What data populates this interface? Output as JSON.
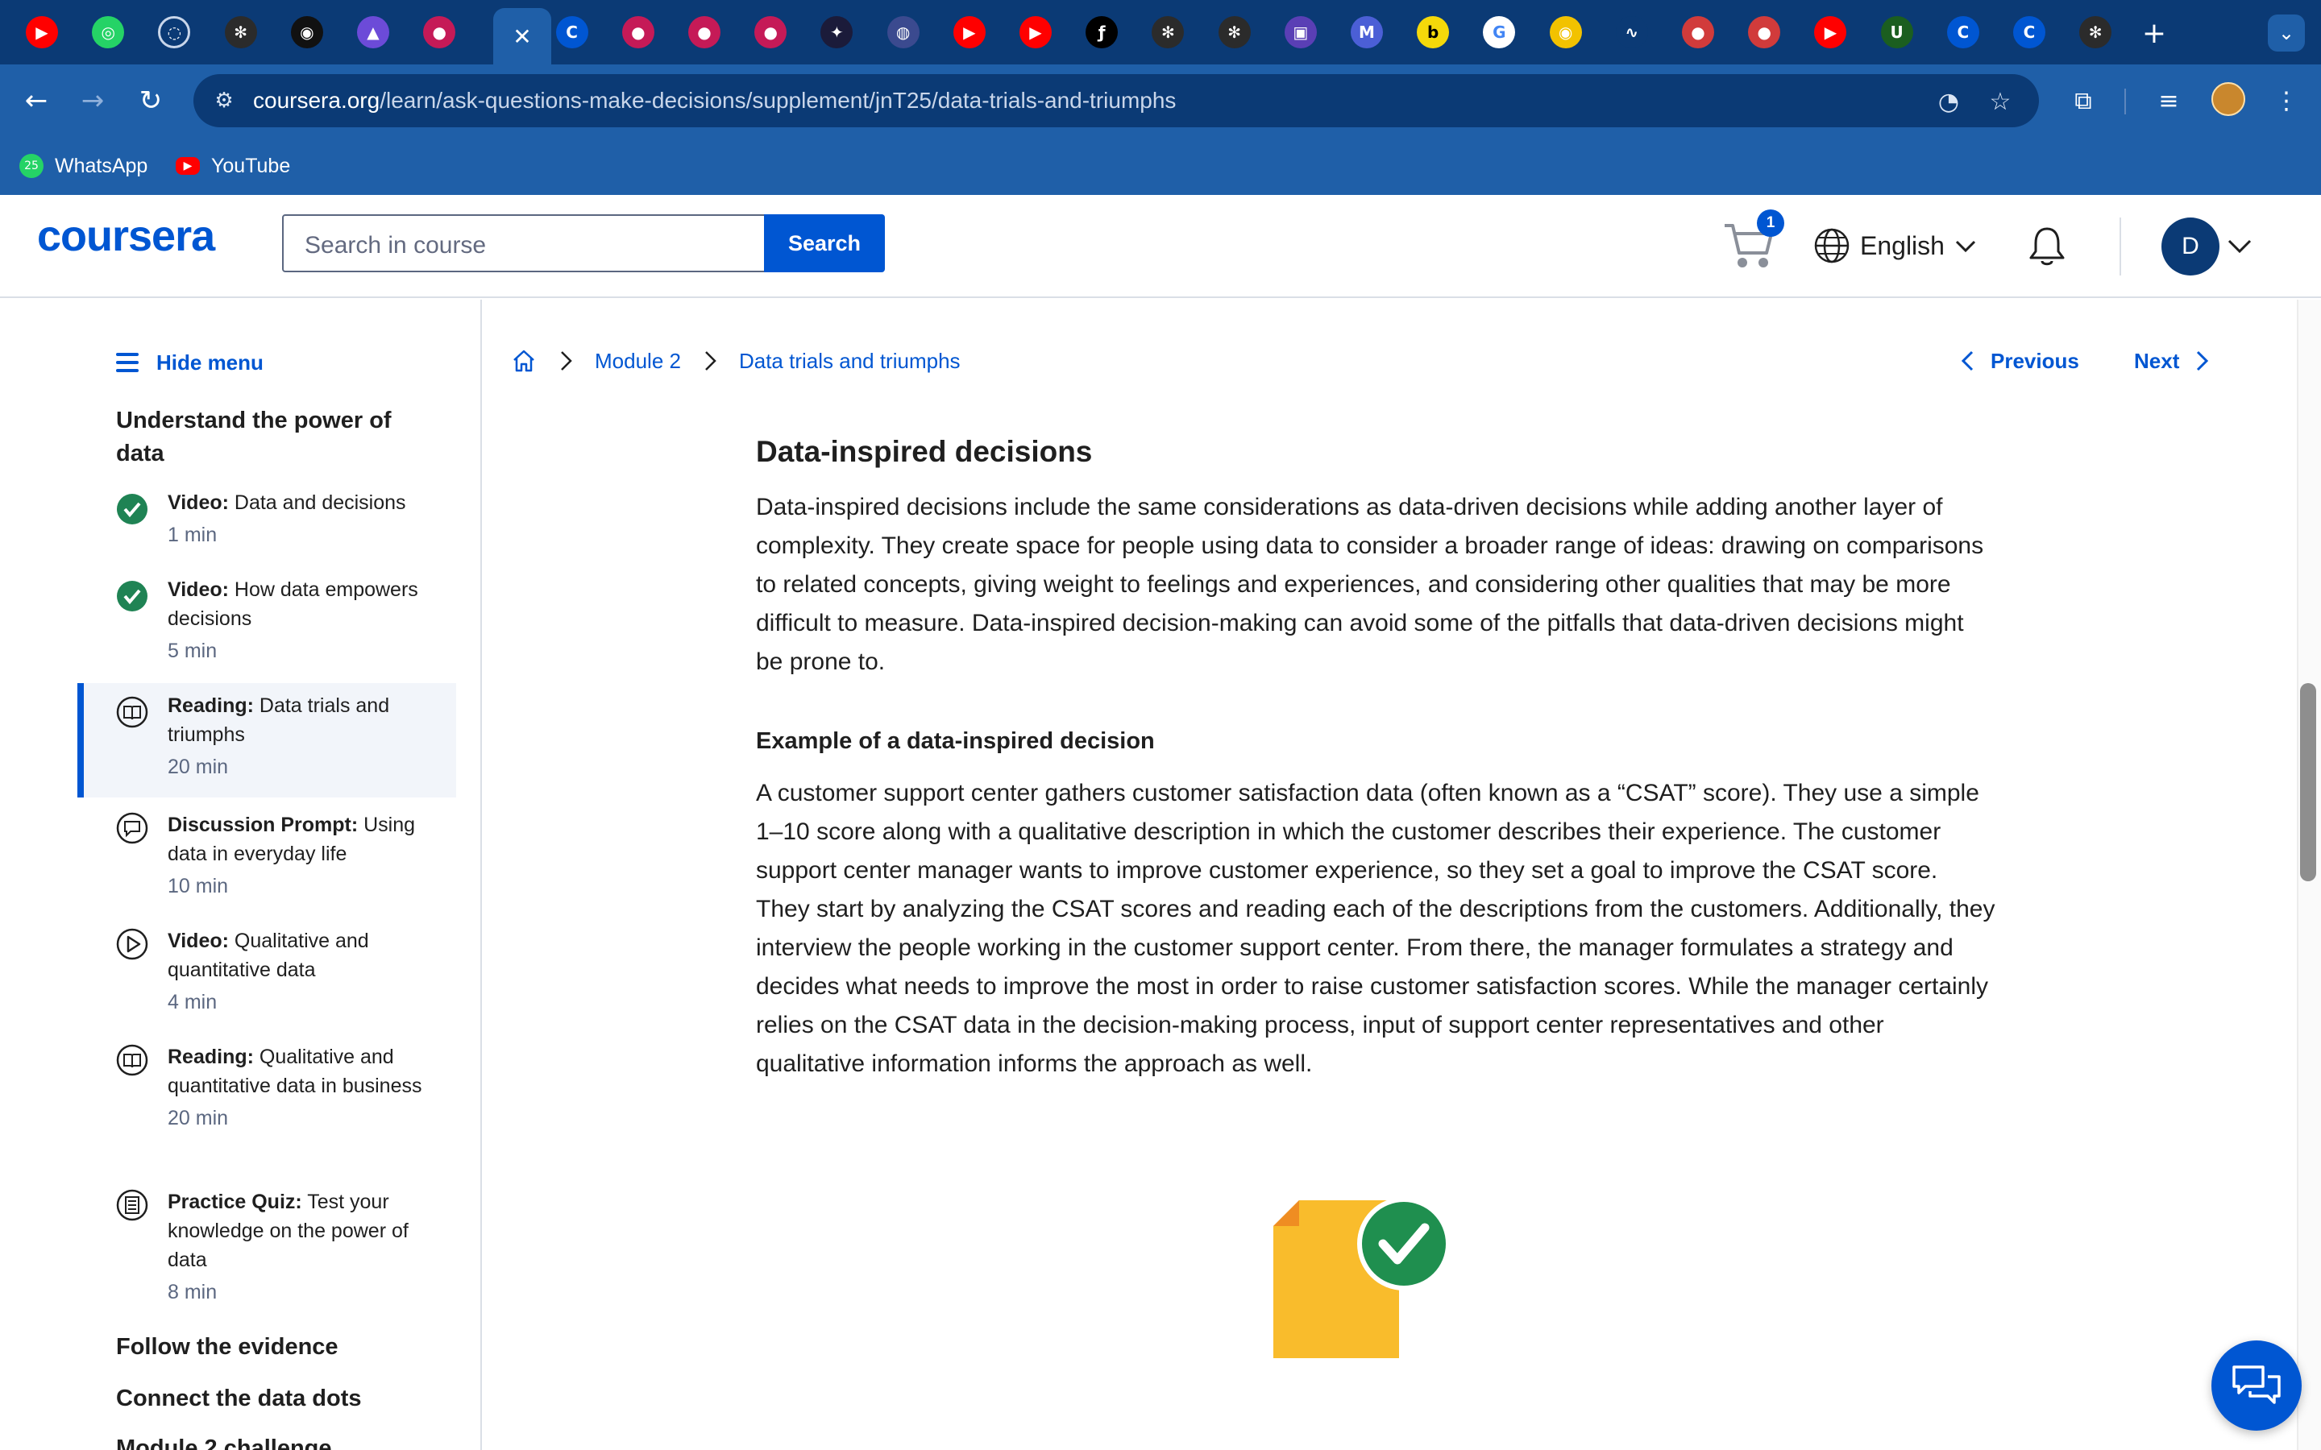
{
  "browser": {
    "tab_favicons": [
      "youtube",
      "whatsapp",
      "loading",
      "openai",
      "github",
      "stack",
      "record",
      "active",
      "coursera",
      "record",
      "record",
      "record",
      "dark",
      "globe",
      "youtube",
      "youtube",
      "signature",
      "openai",
      "openai",
      "camera",
      "m",
      "b",
      "google",
      "circle",
      "wave",
      "ball",
      "ball",
      "youtube",
      "my-unt",
      "coursera",
      "coursera",
      "openai"
    ],
    "active_tab_close": "✕",
    "new_tab_label": "+",
    "tab_search_icon": "⌄",
    "url_host": "coursera.org",
    "url_path": "/learn/ask-questions-make-decisions/supplement/jnT25/data-trials-and-triumphs",
    "bookmarks": [
      {
        "label": "WhatsApp",
        "icon": "whatsapp-icon",
        "badge": "25"
      },
      {
        "label": "YouTube",
        "icon": "youtube-icon"
      }
    ]
  },
  "header": {
    "logo": "coursera",
    "search_placeholder": "Search in course",
    "search_button": "Search",
    "cart_count": "1",
    "language": "English",
    "avatar_initial": "D",
    "brand_color": "#0056d2"
  },
  "sidebar": {
    "hide_menu": "Hide menu",
    "section_title": "Understand the power of data",
    "items": [
      {
        "type": "Video:",
        "title": "Data and decisions",
        "duration": "1 min",
        "status": "completed"
      },
      {
        "type": "Video:",
        "title": "How data empowers decisions",
        "duration": "5 min",
        "status": "completed"
      },
      {
        "type": "Reading:",
        "title": "Data trials and triumphs",
        "duration": "20 min",
        "status": "active"
      },
      {
        "type": "Discussion Prompt:",
        "title": "Using data in everyday life",
        "duration": "10 min",
        "status": "discussion"
      },
      {
        "type": "Video:",
        "title": "Qualitative and quantitative data",
        "duration": "4 min",
        "status": "video"
      },
      {
        "type": "Reading:",
        "title": "Qualitative and quantitative data in business",
        "duration": "20 min",
        "status": "reading"
      },
      {
        "type": "Practice Quiz:",
        "title": "Test your knowledge on the power of data",
        "duration": "8 min",
        "status": "quiz"
      }
    ],
    "modules": [
      "Follow the evidence",
      "Connect the data dots",
      "Module 2 challenge"
    ]
  },
  "breadcrumb": {
    "module": "Module 2",
    "page": "Data trials and triumphs"
  },
  "nav": {
    "previous": "Previous",
    "next": "Next"
  },
  "article": {
    "heading": "Data-inspired decisions",
    "paragraph1": "Data-inspired decisions include the same considerations as data-driven decisions while adding another layer of complexity. They create space for people using data to consider a broader range of ideas: drawing on comparisons to related concepts, giving weight to feelings and experiences, and considering other qualities that may be more difficult to measure. Data-inspired decision-making can avoid some of the pitfalls that data-driven decisions might be prone to.",
    "subheading": "Example of a data-inspired decision",
    "paragraph2": "A customer support center gathers customer satisfaction data (often known as a “CSAT” score). They use a simple 1–10 score along with a qualitative description in which the customer describes their experience. The customer support center manager wants to improve customer experience, so they set a goal to improve the CSAT score. They start by analyzing the CSAT scores and reading each of the descriptions from the customers. Additionally, they interview the people working in the customer support center. From there, the manager formulates a strategy and decides what needs to improve the most in order to raise customer satisfaction scores. While the manager certainly relies on the CSAT data in the decision-making process, input of support center representatives and other qualitative information informs the approach as well."
  }
}
